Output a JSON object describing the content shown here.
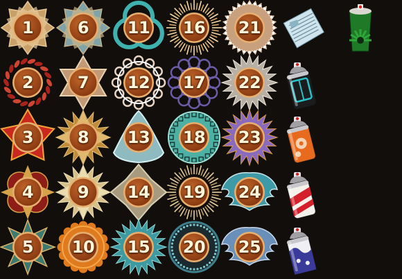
{
  "badges": [
    {
      "label": "1",
      "frame": "star8",
      "color": "#c9a06a",
      "accent": "#e8c999"
    },
    {
      "label": "2",
      "frame": "wreath",
      "color": "#a8231b",
      "accent": "#d04532"
    },
    {
      "label": "3",
      "frame": "star5",
      "color": "#c8281e",
      "accent": "#f0a43a"
    },
    {
      "label": "4",
      "frame": "quatrefoil",
      "color": "#8e1c17",
      "accent": "#d6a24a"
    },
    {
      "label": "5",
      "frame": "star8sharp",
      "color": "#3f7a6e",
      "accent": "#d9b36c"
    },
    {
      "label": "6",
      "frame": "star8",
      "color": "#7fa3a8",
      "accent": "#c7b38a"
    },
    {
      "label": "7",
      "frame": "star6",
      "color": "#c29a78",
      "accent": "#e8d2b0"
    },
    {
      "label": "8",
      "frame": "sunburst",
      "color": "#c08c3a",
      "accent": "#e6c27a"
    },
    {
      "label": "9",
      "frame": "sunburst",
      "color": "#d8c08a",
      "accent": "#f0e2b6"
    },
    {
      "label": "10",
      "frame": "scallop",
      "color": "#e07a1e",
      "accent": "#f4a84a"
    },
    {
      "label": "11",
      "frame": "trefoil",
      "color": "#3fb2b0",
      "accent": "#88e0dc"
    },
    {
      "label": "12",
      "frame": "snowflake",
      "color": "#e6d3c4",
      "accent": "#ffffff"
    },
    {
      "label": "13",
      "frame": "triangle",
      "color": "#8fbac0",
      "accent": "#d2eef0"
    },
    {
      "label": "14",
      "frame": "diamond",
      "color": "#a89a7e",
      "accent": "#d8cfb2"
    },
    {
      "label": "15",
      "frame": "spikes",
      "color": "#3d9aa0",
      "accent": "#8fd4d4"
    },
    {
      "label": "16",
      "frame": "rays",
      "color": "#d4a56a",
      "accent": "#f4d9a8"
    },
    {
      "label": "17",
      "frame": "rings",
      "color": "#6a5da8",
      "accent": "#a89be0"
    },
    {
      "label": "18",
      "frame": "greek",
      "color": "#4cb0a4",
      "accent": "#9ee2d6"
    },
    {
      "label": "19",
      "frame": "rays",
      "color": "#b89a6a",
      "accent": "#e6d0a4"
    },
    {
      "label": "20",
      "frame": "dotring",
      "color": "#3f7f8c",
      "accent": "#7fc4cc"
    },
    {
      "label": "21",
      "frame": "gear",
      "color": "#c8a07e",
      "accent": "#f0d8bc"
    },
    {
      "label": "22",
      "frame": "spikes",
      "color": "#b8b0a4",
      "accent": "#ece6dc"
    },
    {
      "label": "23",
      "frame": "spikes",
      "color": "#8a6abf",
      "accent": "#d99a4a"
    },
    {
      "label": "24",
      "frame": "wings",
      "color": "#3f9aa8",
      "accent": "#c9e6ea"
    },
    {
      "label": "25",
      "frame": "wings",
      "color": "#6a8fb8",
      "accent": "#c8d8ea"
    }
  ],
  "items": [
    {
      "name": "newspaper",
      "icon": "newspaper-icon"
    },
    {
      "name": "spray-can-tron",
      "icon": "spray-can-icon",
      "color": "#2ac0c8",
      "body": "#1a1c1e"
    },
    {
      "name": "spray-can-flower",
      "icon": "spray-can-icon",
      "color": "#e86a1e",
      "body": "#e86a1e"
    },
    {
      "name": "spray-can-stripes",
      "icon": "spray-can-icon",
      "color": "#d4202a",
      "body": "#f4f0ea"
    },
    {
      "name": "spray-can-wave",
      "icon": "spray-can-icon",
      "color": "#3a3a9a",
      "body": "#f0f0f4"
    },
    {
      "name": "paint-bucket-green",
      "icon": "paint-bucket-icon",
      "color": "#2fa83a",
      "body": "#1f7a28"
    }
  ],
  "palette": {
    "background": "#120e0c",
    "medal_core": "#8a3a12",
    "medal_core_light": "#c2662a",
    "medal_rim": "#e8b070"
  }
}
